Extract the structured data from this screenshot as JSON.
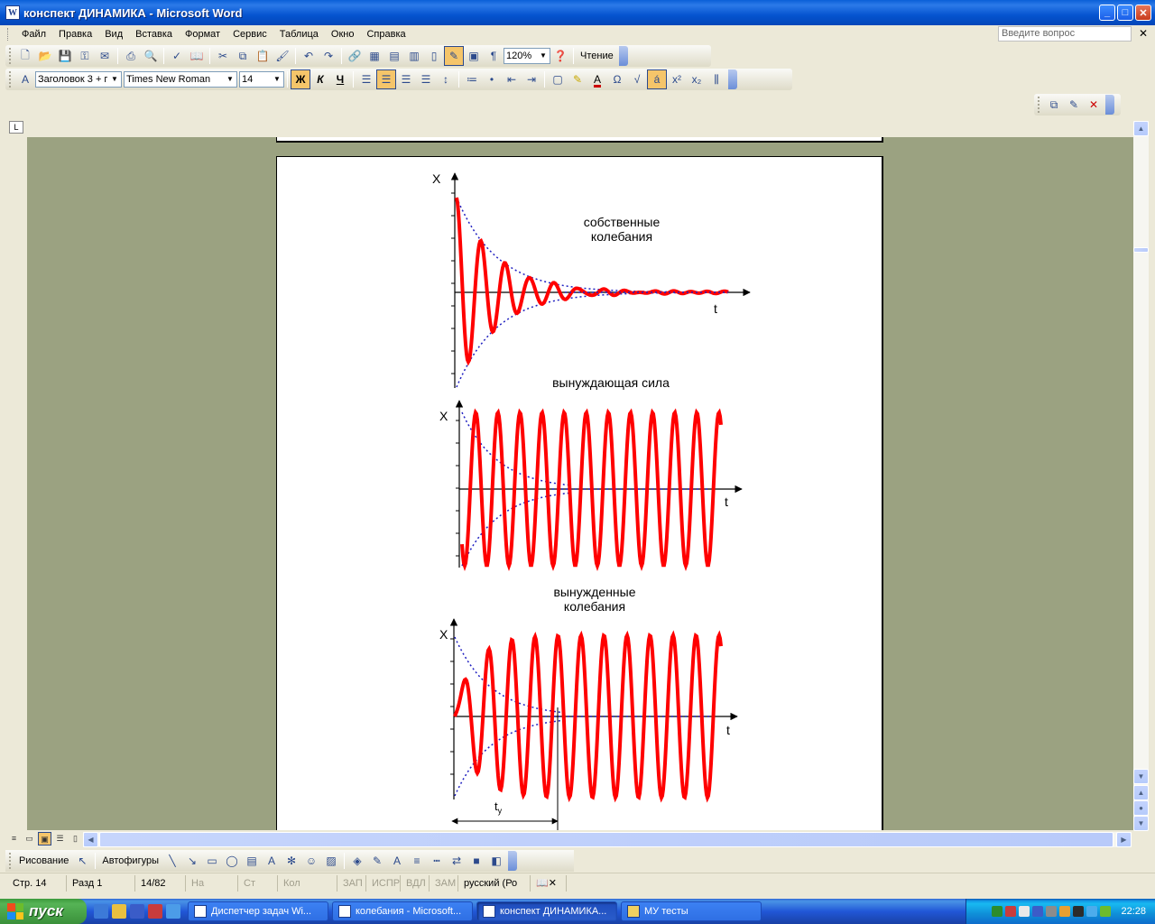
{
  "window": {
    "title": "конспект ДИНАМИКА - Microsoft Word"
  },
  "menu": {
    "items": [
      "Файл",
      "Правка",
      "Вид",
      "Вставка",
      "Формат",
      "Сервис",
      "Таблица",
      "Окно",
      "Справка"
    ],
    "ask_placeholder": "Введите вопрос"
  },
  "toolbar_standard": {
    "zoom": "120%",
    "reading_label": "Чтение"
  },
  "toolbar_formatting": {
    "style": "Заголовок 3 + г",
    "font": "Times New Roman",
    "size": "14",
    "bold": "Ж",
    "italic": "К",
    "underline": "Ч"
  },
  "document": {
    "chart1_caption_line1": "собственные",
    "chart1_caption_line2": "колебания",
    "chart2_caption": "вынуждающая сила",
    "chart3_caption_line1": "вынужденные",
    "chart3_caption_line2": "колебания",
    "axis_y": "X",
    "axis_x": "t",
    "settle_label": "t",
    "settle_sub": "у"
  },
  "chart_data": [
    {
      "type": "line",
      "title": "собственные колебания",
      "xlabel": "t",
      "ylabel": "X",
      "series": [
        {
          "values": "damped oscillation with exponential envelope"
        }
      ]
    },
    {
      "type": "line",
      "title": "вынуждающая сила",
      "xlabel": "t",
      "ylabel": "X",
      "series": [
        {
          "values": "constant-amplitude sinusoid, 12 periods"
        }
      ]
    },
    {
      "type": "line",
      "title": "вынужденные колебания",
      "xlabel": "t",
      "ylabel": "X",
      "series": [
        {
          "values": "transient then steady forced oscillation"
        }
      ]
    }
  ],
  "drawing_toolbar": {
    "draw_label": "Рисование",
    "autoshapes_label": "Автофигуры"
  },
  "status": {
    "page": "Стр. 14",
    "section": "Разд 1",
    "pages": "14/82",
    "at": "На",
    "line": "Ст",
    "col": "Кол",
    "rec": "ЗАП",
    "trk": "ИСПР",
    "ext": "ВДЛ",
    "ovr": "ЗАМ",
    "lang": "русский (Ро"
  },
  "taskbar": {
    "start": "пуск",
    "tasks": [
      "Диспетчер задач Wi...",
      "колебания - Microsoft...",
      "конспект ДИНАМИКА...",
      "МУ тесты"
    ],
    "clock": "22:28"
  },
  "colors": {
    "title_bar": "#0a5fd8",
    "doc_bg": "#9ba281",
    "curve": "#ff0000",
    "envelope": "#2020c0"
  }
}
